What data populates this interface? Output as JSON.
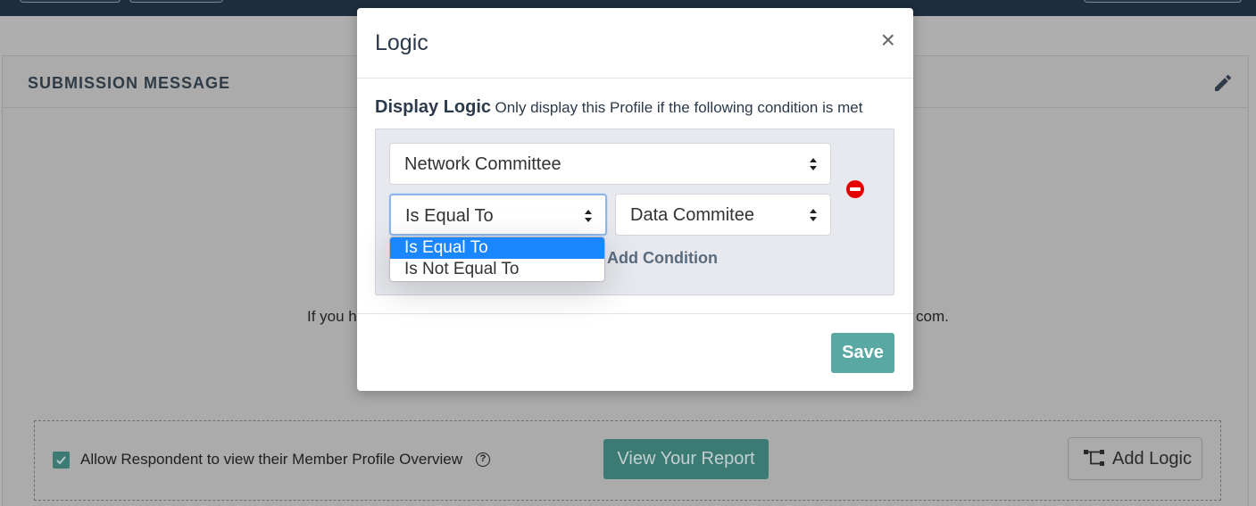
{
  "background": {
    "card_title": "SUBMISSION MESSAGE",
    "body_text_left": "If you h",
    "body_text_right": "com.",
    "options": {
      "allow_view_label": "Allow Respondent to view their Member Profile Overview",
      "allow_view_checked": true,
      "view_report_label": "View Your Report",
      "add_logic_label": "Add Logic"
    }
  },
  "modal": {
    "title": "Logic",
    "close_symbol": "×",
    "display_logic_heading": "Display Logic",
    "display_logic_hint": "Only display this Profile if the following condition is met",
    "condition": {
      "field_value": "Network Committee",
      "operator_value": "Is Equal To",
      "target_value": "Data Commitee"
    },
    "operator_options": [
      "Is Equal To",
      "Is Not Equal To"
    ],
    "operator_selected_index": 0,
    "add_condition_label": "Add Condition",
    "save_label": "Save"
  },
  "colors": {
    "accent_teal": "#5aa8a3",
    "remove_red": "#e60000",
    "dropdown_highlight": "#1a86ff"
  },
  "icons": [
    "edit-icon",
    "close-icon",
    "select-caret-icon",
    "remove-icon",
    "checkbox-check-icon",
    "help-icon",
    "logic-branch-icon"
  ]
}
